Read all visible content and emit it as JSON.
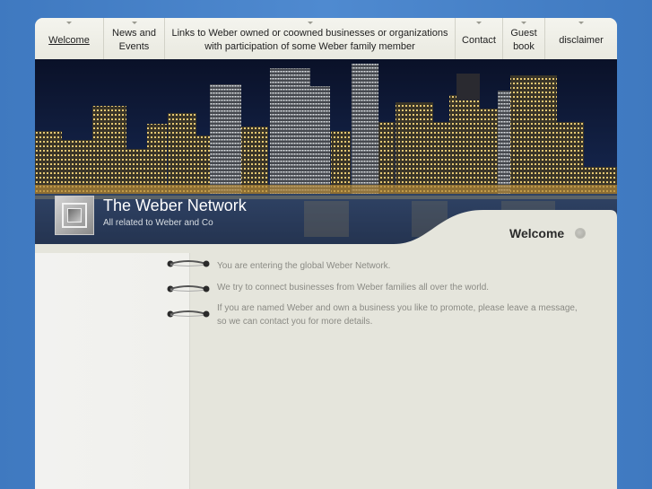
{
  "nav": {
    "items": [
      {
        "label": "Welcome",
        "active": true
      },
      {
        "label": "News and Events"
      },
      {
        "label": "Links to Weber owned or coowned businesses or organizations with participation of some Weber family member"
      },
      {
        "label": "Contact"
      },
      {
        "label": "Guest book"
      },
      {
        "label": "disclaimer"
      }
    ]
  },
  "header": {
    "title": "The Weber Network",
    "subtitle": "All related to Weber and Co"
  },
  "section": {
    "heading": "Welcome"
  },
  "content": {
    "items": [
      "You are entering the global Weber Network.",
      "We try to connect businesses from Weber families all over the world.",
      "If you are named Weber and own a business you like to promote, please leave a message, so we can contact you for more details."
    ]
  },
  "colors": {
    "background": "#4a84cc",
    "panel": "#e5e5dc",
    "night_sky": "#0c1530",
    "text_muted": "#8a8a84"
  }
}
